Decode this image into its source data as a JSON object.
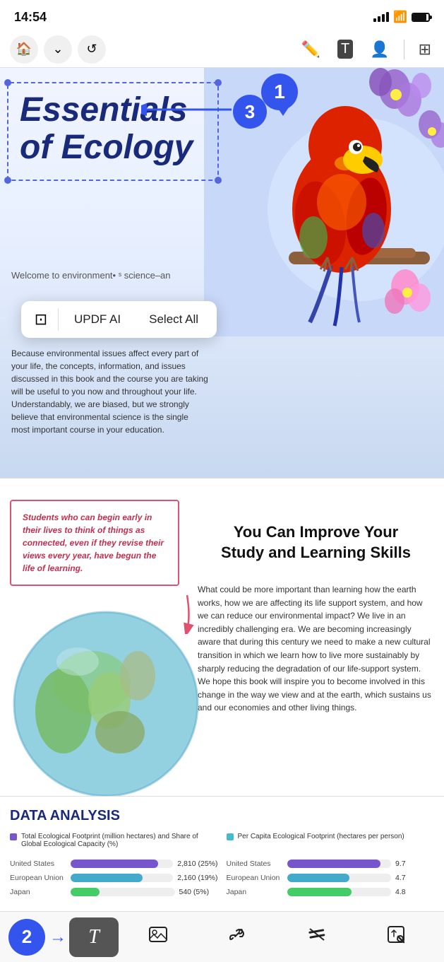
{
  "status": {
    "time": "14:54",
    "signal": "full",
    "wifi": true,
    "battery": "full"
  },
  "toolbar": {
    "home_label": "🏠",
    "dropdown_label": "⌄",
    "back_label": "↺",
    "pen_label": "✏",
    "text_select_label": "T",
    "share_label": "👤",
    "grid_label": "⊞"
  },
  "annotation_bubbles": {
    "bubble1": "1",
    "bubble2": "2",
    "bubble3": "3"
  },
  "book": {
    "title_line1": "Essentials",
    "title_line2": "of Ecology",
    "welcome_text": "Welcome to environment• ˢ science–an",
    "body_text": "Because environmental issues affect every part of your life, the concepts, information, and issues discussed in this book and the course you are taking will be useful to you now and throughout your life. Understandably, we are biased, but we strongly believe that environmental science is the single most important course in your education."
  },
  "context_menu": {
    "ocr_icon": "⊡",
    "ai_label": "UPDF AI",
    "select_all_label": "Select All"
  },
  "learning_section": {
    "quote": "Students who can begin early in their lives to think of things as connected, even if they revise their views every year, have begun the life of learning.",
    "heading_line1": "You Can Improve Your",
    "heading_line2": "Study and Learning Skills",
    "body": "What could be more important than learning how the earth works, how we are affecting its life support system, and how we can reduce our environmental impact? We live in an incredibly challenging era. We are becoming increasingly aware that during this century we need to make a new cultural transition in which we learn how to live more sustainably by sharply reducing the degradation of our life-support system. We hope this book will inspire you to become involved in this change in the way we view and at the earth, which sustains us and our economies and other living things."
  },
  "data_analysis": {
    "title": "DATA ANALYSIS",
    "col1_header": "Total Ecological Footprint (million hectares) and Share of Global Ecological Capacity (%)",
    "col2_header": "Per Capita Ecological Footprint (hectares per person)",
    "col1_color": "#7755cc",
    "col2_color": "#44bbcc",
    "rows": [
      {
        "label": "United States",
        "val1": "2,810 (25%)",
        "pct1": 85,
        "val2": "9.7",
        "pct2": 90
      },
      {
        "label": "European Union",
        "val1": "2,160 (19%)",
        "pct1": 70,
        "val2": "4.7",
        "pct2": 60
      },
      {
        "label": "Japan",
        "val1": "540 (5%)",
        "pct1": 28,
        "val2": "4.8",
        "pct2": 62
      }
    ]
  },
  "bottom_toolbar": {
    "text_tool": "𝓣",
    "image_tool": "🖼",
    "link_tool": "🔗",
    "markup_tool": "✒",
    "select_tool": "⊡"
  }
}
